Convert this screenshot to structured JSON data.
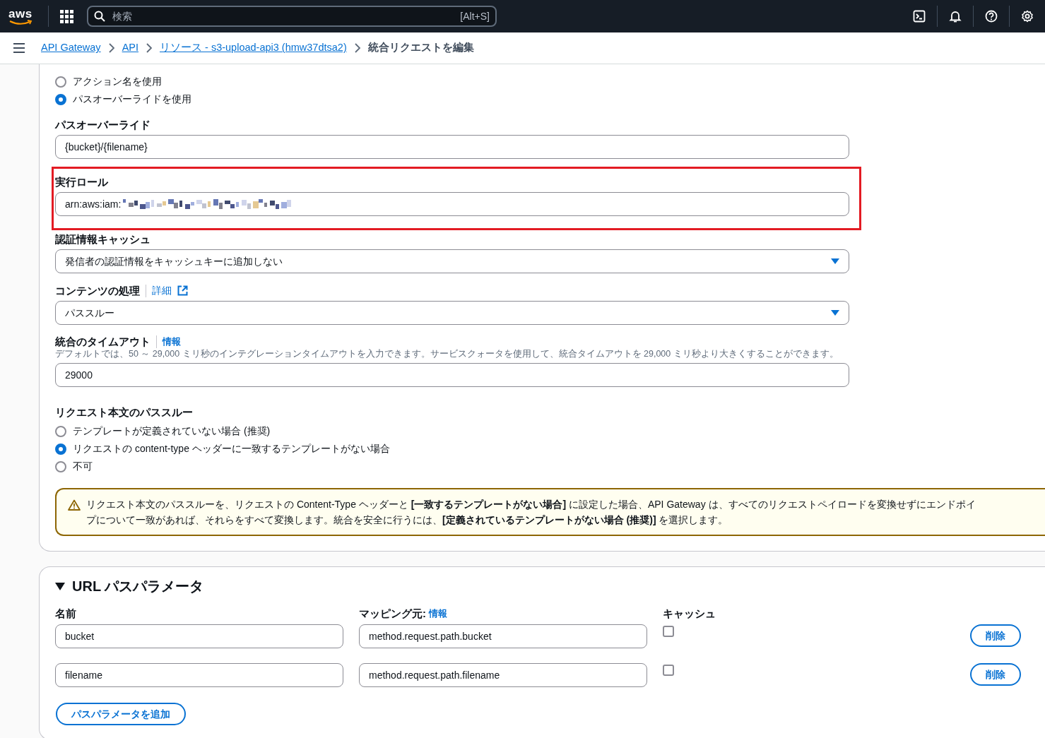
{
  "topbar": {
    "logo": "aws",
    "search_placeholder": "検索",
    "shortcut": "[Alt+S]"
  },
  "breadcrumbs": [
    {
      "label": "API Gateway",
      "link": true
    },
    {
      "label": "API",
      "link": true
    },
    {
      "label": "リソース - s3-upload-api3 (hmw37dtsa2)",
      "link": true
    },
    {
      "label": "統合リクエストを編集",
      "link": false
    }
  ],
  "action_options": [
    {
      "label": "アクション名を使用",
      "selected": false
    },
    {
      "label": "パスオーバーライドを使用",
      "selected": true
    }
  ],
  "fields": [
    {
      "kind": "text",
      "label": "パスオーバーライド",
      "value": "{bucket}/{filename}",
      "highlighted": false
    },
    {
      "kind": "text",
      "label": "実行ロール",
      "value": "arn:aws:iam:",
      "redacted": true,
      "highlighted": true
    },
    {
      "kind": "select",
      "label": "認証情報キャッシュ",
      "value": "発信者の認証情報をキャッシュキーに追加しない",
      "highlighted": false
    },
    {
      "kind": "select",
      "label": "コンテンツの処理",
      "link": {
        "text": "詳細",
        "external": true
      },
      "value": "パススルー",
      "highlighted": false
    },
    {
      "kind": "text",
      "label": "統合のタイムアウト",
      "link": {
        "text": "情報",
        "external": false
      },
      "description": "デフォルトでは、50 ～ 29,000 ミリ秒のインテグレーションタイムアウトを入力できます。サービスクォータを使用して、統合タイムアウトを 29,000 ミリ秒より大きくすることができます。",
      "value": "29000",
      "highlighted": false
    }
  ],
  "passthrough": {
    "label": "リクエスト本文のパススルー",
    "options": [
      {
        "label": "テンプレートが定義されていない場合 (推奨)",
        "selected": false
      },
      {
        "label": "リクエストの content-type ヘッダーに一致するテンプレートがない場合",
        "selected": true
      },
      {
        "label": "不可",
        "selected": false
      }
    ]
  },
  "warning": {
    "lines": [
      "リクエスト本文のパススルーを、リクエストの Content-Type ヘッダーと **[一致するテンプレートがない場合]** に設定した場合、API Gateway は、すべてのリクエストペイロードを変換せずにエンドポイ",
      "プについて一致があれば、それらをすべて変換します。統合を安全に行うには、**[定義されているテンプレートがない場合 (推奨)]** を選択します。"
    ]
  },
  "url_params": {
    "title": "URL パスパラメータ",
    "expanded": true,
    "columns": [
      "名前",
      "マッピング元:",
      "キャッシュ"
    ],
    "mapping_info": "情報",
    "rows": [
      {
        "name": "bucket",
        "mapping": "method.request.path.bucket",
        "cache": false,
        "action": "削除"
      },
      {
        "name": "filename",
        "mapping": "method.request.path.filename",
        "cache": false,
        "action": "削除"
      }
    ],
    "add_button": "パスパラメータを追加"
  }
}
